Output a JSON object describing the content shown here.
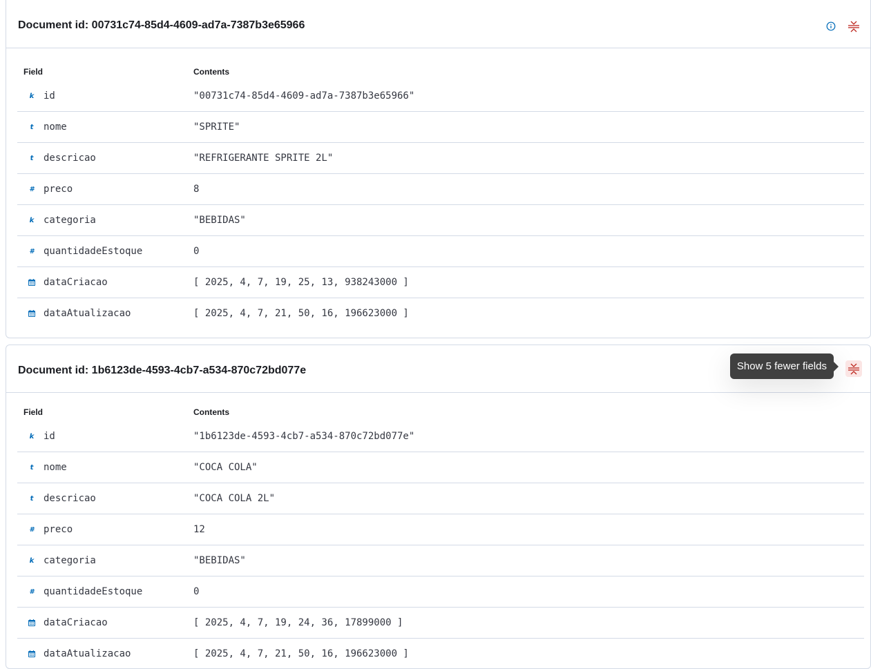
{
  "colors": {
    "accent": "#006bb8",
    "danger": "#bd271e",
    "border": "#d3dae6"
  },
  "documents": [
    {
      "title": "Document id: 00731c74-85d4-4609-ad7a-7387b3e65966",
      "field_header": "Field",
      "contents_header": "Contents",
      "fields": [
        {
          "type_icon": "k",
          "icon_name": "keyword-icon",
          "name": "id",
          "value": "\"00731c74-85d4-4609-ad7a-7387b3e65966\""
        },
        {
          "type_icon": "t",
          "icon_name": "text-icon",
          "name": "nome",
          "value": "\"SPRITE\""
        },
        {
          "type_icon": "t",
          "icon_name": "text-icon",
          "name": "descricao",
          "value": "\"REFRIGERANTE SPRITE 2L\""
        },
        {
          "type_icon": "#",
          "icon_name": "number-icon",
          "name": "preco",
          "value": "8"
        },
        {
          "type_icon": "k",
          "icon_name": "keyword-icon",
          "name": "categoria",
          "value": "\"BEBIDAS\""
        },
        {
          "type_icon": "#",
          "icon_name": "number-icon",
          "name": "quantidadeEstoque",
          "value": "0"
        },
        {
          "type_icon": "date",
          "icon_name": "date-icon",
          "name": "dataCriacao",
          "value": "[ 2025, 4, 7, 19, 25, 13, 938243000 ]"
        },
        {
          "type_icon": "date",
          "icon_name": "date-icon",
          "name": "dataAtualizacao",
          "value": "[ 2025, 4, 7, 21, 50, 16, 196623000 ]"
        }
      ]
    },
    {
      "title": "Document id: 1b6123de-4593-4cb7-a534-870c72bd077e",
      "tooltip": "Show 5 fewer fields",
      "field_header": "Field",
      "contents_header": "Contents",
      "fields": [
        {
          "type_icon": "k",
          "icon_name": "keyword-icon",
          "name": "id",
          "value": "\"1b6123de-4593-4cb7-a534-870c72bd077e\""
        },
        {
          "type_icon": "t",
          "icon_name": "text-icon",
          "name": "nome",
          "value": "\"COCA COLA\""
        },
        {
          "type_icon": "t",
          "icon_name": "text-icon",
          "name": "descricao",
          "value": "\"COCA COLA 2L\""
        },
        {
          "type_icon": "#",
          "icon_name": "number-icon",
          "name": "preco",
          "value": "12"
        },
        {
          "type_icon": "k",
          "icon_name": "keyword-icon",
          "name": "categoria",
          "value": "\"BEBIDAS\""
        },
        {
          "type_icon": "#",
          "icon_name": "number-icon",
          "name": "quantidadeEstoque",
          "value": "0"
        },
        {
          "type_icon": "date",
          "icon_name": "date-icon",
          "name": "dataCriacao",
          "value": "[ 2025, 4, 7, 19, 24, 36, 17899000 ]"
        },
        {
          "type_icon": "date",
          "icon_name": "date-icon",
          "name": "dataAtualizacao",
          "value": "[ 2025, 4, 7, 21, 50, 16, 196623000 ]"
        }
      ]
    }
  ]
}
